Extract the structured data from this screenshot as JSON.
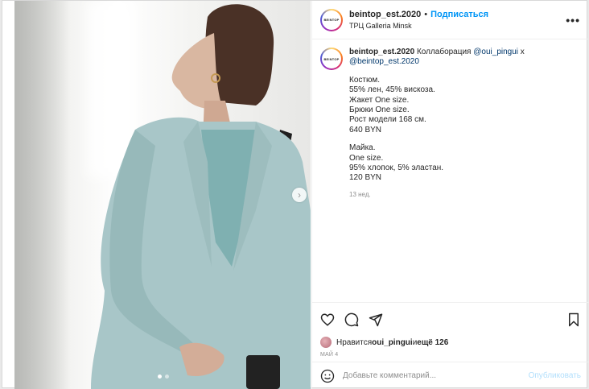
{
  "post": {
    "username": "beintop_est.2020",
    "avatar_text": "BEINTOP",
    "follow_label": "Подписаться",
    "location": "ТРЦ Galleria Minsk",
    "more_icon": "more-horizontal-icon"
  },
  "caption": {
    "username": "beintop_est.2020",
    "text_prefix": "Коллаборация ",
    "mention1": "@oui_pingui",
    "text_mid": " x",
    "mention2": "@beintop_est.2020",
    "block1": [
      "Костюм.",
      "55% лен, 45% вискоза.",
      "Жакет One size.",
      "Брюки One size.",
      "Рост модели 168 см.",
      "640 BYN"
    ],
    "block2": [
      "Майка.",
      "One size.",
      "95% хлопок, 5% эластан.",
      "120 BYN"
    ],
    "time": "13 нед."
  },
  "actions": {
    "like_icon": "heart-icon",
    "comment_icon": "comment-icon",
    "share_icon": "share-icon",
    "save_icon": "bookmark-icon"
  },
  "likes": {
    "prefix": "Нравится ",
    "user": "oui_pingui",
    "mid": " и ",
    "others": "ещё 126"
  },
  "date": "МАЙ 4",
  "comment_box": {
    "placeholder": "Добавьте комментарий...",
    "post_label": "Опубликовать"
  }
}
